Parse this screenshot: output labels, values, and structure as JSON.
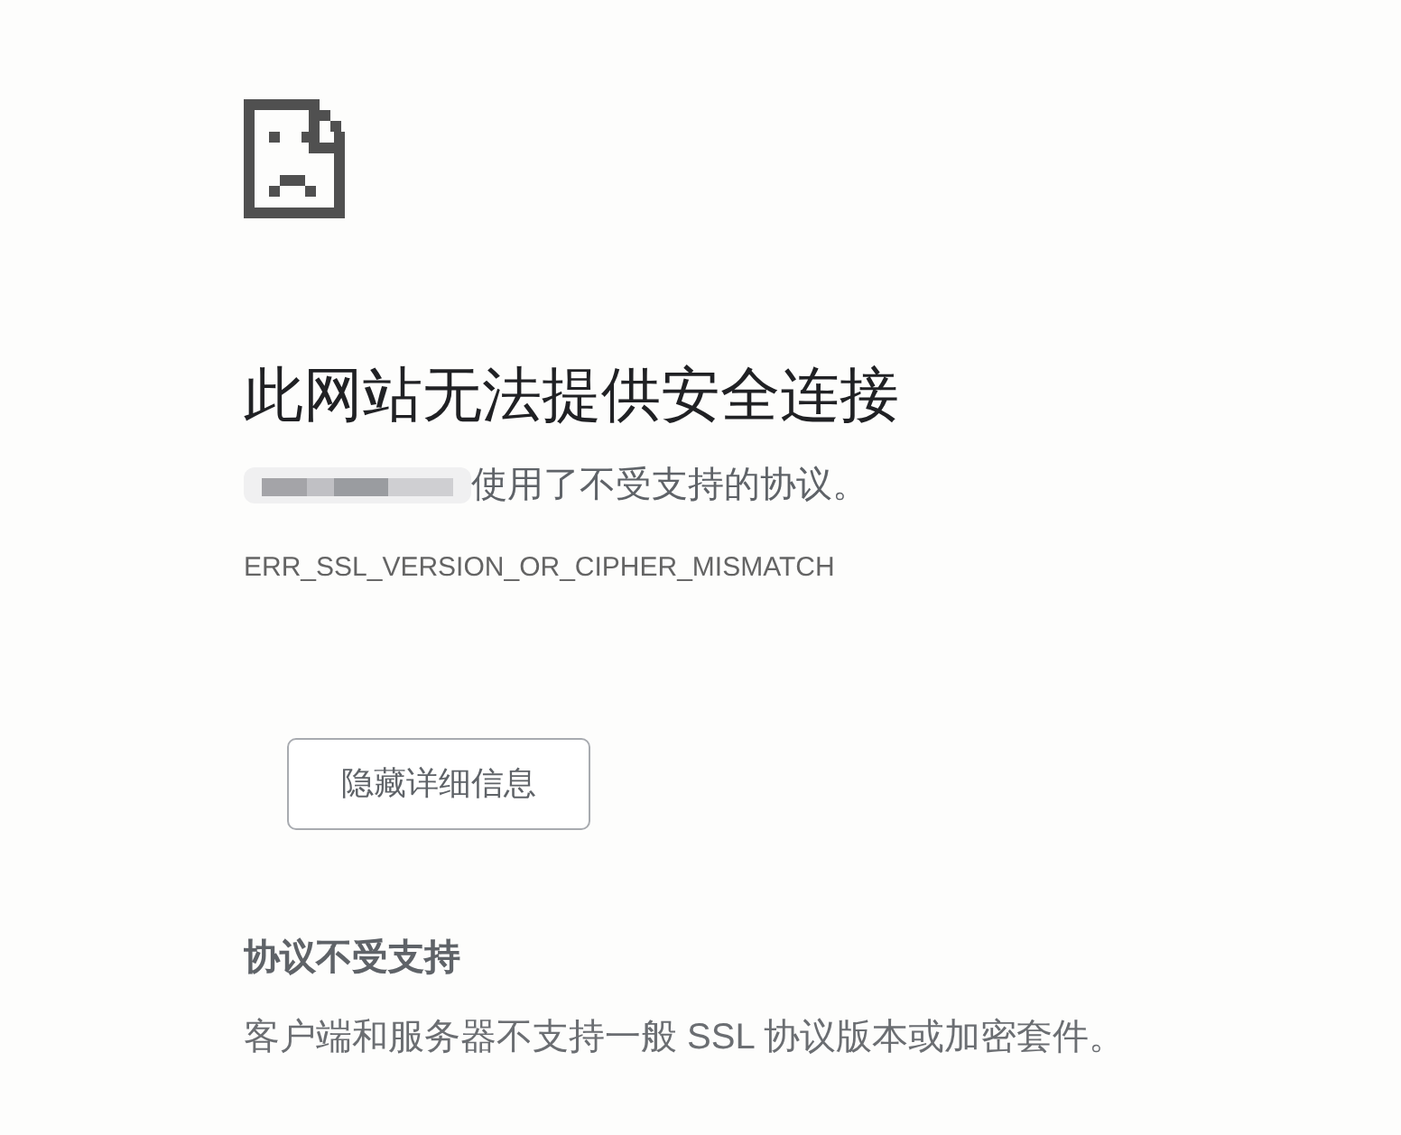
{
  "heading": "此网站无法提供安全连接",
  "message": "使用了不受支持的协议。",
  "error_code": "ERR_SSL_VERSION_OR_CIPHER_MISMATCH",
  "details_button": "隐藏详细信息",
  "details": {
    "title": "协议不受支持",
    "text": "客户端和服务器不支持一般 SSL 协议版本或加密套件。"
  }
}
